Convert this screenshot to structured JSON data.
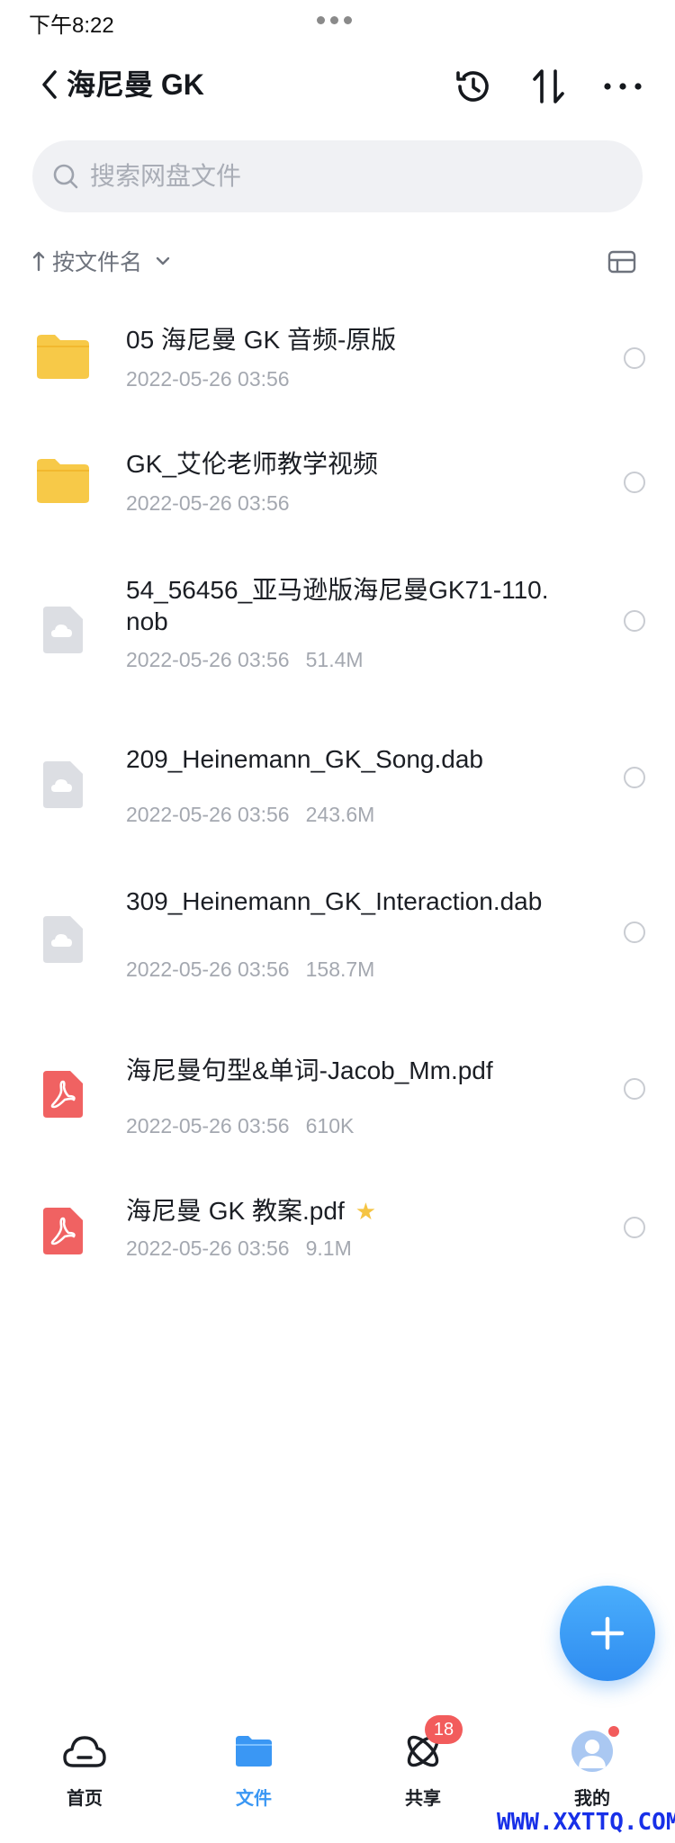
{
  "status_bar": {
    "time": "下午8:22"
  },
  "header": {
    "title": "海尼曼 GK"
  },
  "search": {
    "placeholder": "搜索网盘文件"
  },
  "sort": {
    "label": "按文件名"
  },
  "files": [
    {
      "name": "05 海尼曼 GK 音频-原版",
      "date": "2022-05-26 03:56",
      "size": "",
      "type": "folder"
    },
    {
      "name": "GK_艾伦老师教学视频",
      "date": "2022-05-26 03:56",
      "size": "",
      "type": "folder"
    },
    {
      "name": "54_56456_亚马逊版海尼曼GK71-110.nob",
      "date": "2022-05-26 03:56",
      "size": "51.4M",
      "type": "cloud-file"
    },
    {
      "name": "209_Heinemann_GK_Song.dab",
      "date": "2022-05-26 03:56",
      "size": "243.6M",
      "type": "cloud-file"
    },
    {
      "name": "309_Heinemann_GK_Interaction.dab",
      "date": "2022-05-26 03:56",
      "size": "158.7M",
      "type": "cloud-file"
    },
    {
      "name": "海尼曼句型&单词-Jacob_Mm.pdf",
      "date": "2022-05-26 03:56",
      "size": "610K",
      "type": "pdf"
    },
    {
      "name": "海尼曼 GK 教案.pdf",
      "date": "2022-05-26 03:56",
      "size": "9.1M",
      "type": "pdf"
    }
  ],
  "tabs": [
    {
      "label": "首页",
      "icon": "cloud-home-icon"
    },
    {
      "label": "文件",
      "icon": "folder-icon"
    },
    {
      "label": "共享",
      "icon": "share-orbit-icon",
      "badge": "18"
    },
    {
      "label": "我的",
      "icon": "avatar-icon"
    }
  ],
  "colors": {
    "accent": "#3a97f4",
    "folder": "#f7c948",
    "pdf": "#f06262",
    "badge": "#f25c5c"
  },
  "watermark": "WWW.XXTTQ.COM"
}
